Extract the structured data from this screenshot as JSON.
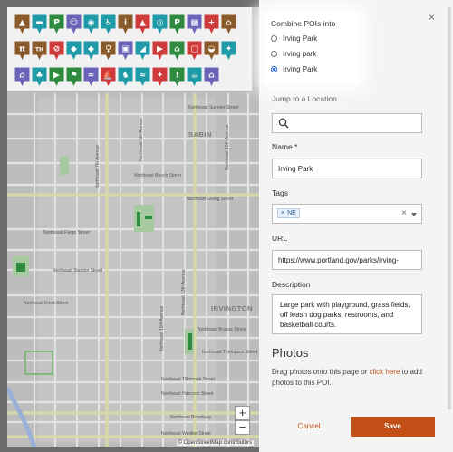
{
  "combine": {
    "title": "Combine POIs into",
    "options": [
      {
        "label": "Irving Park",
        "selected": false
      },
      {
        "label": "Irving park",
        "selected": false
      },
      {
        "label": "Irving Park",
        "selected": true
      }
    ]
  },
  "form": {
    "close_glyph": "×",
    "jump_label": "Jump to a Location",
    "jump_value": "",
    "name_label": "Name *",
    "name_value": "Irving Park",
    "tags_label": "Tags",
    "tag_chip": "NE",
    "tag_chip_remove": "×",
    "tags_clear": "×",
    "url_label": "URL",
    "url_value": "https://www.portland.gov/parks/irving-",
    "description_label": "Description",
    "description_value": "Large park with playground, grass fields, off leash dog parks, restrooms, and basketball courts.",
    "photos_title": "Photos",
    "photos_help_before": "Drag photos onto this page or ",
    "photos_help_link": "click here",
    "photos_help_after": " to add photos to this POI.",
    "cancel_label": "Cancel",
    "save_label": "Save"
  },
  "map": {
    "zoom_in": "+",
    "zoom_out": "−",
    "attribution": "© OpenStreetMap contributors",
    "areas": [
      "SABIN",
      "IRVINGTON"
    ],
    "streets_h": [
      "Northeast Beech Street",
      "Northeast Fargo Street",
      "Northeast Stanton Street",
      "Northeast Knott Street",
      "Northeast Brazee Street",
      "Northeast Thompson Street",
      "Northeast Tillamook Street",
      "Northeast Hancock Street",
      "Northeast Broadway",
      "Northeast Weidler Street",
      "Northeast Going Street",
      "Northeast Sumner Street"
    ],
    "streets_v": [
      "Northeast 7th Avenue",
      "Northeast 9th Avenue",
      "Northeast 11th Avenue",
      "Northeast 13th Avenue",
      "Northeast 15th Avenue"
    ]
  },
  "palette_icons": [
    "tent-icon",
    "bench-icon",
    "parking-icon",
    "restroom-icon",
    "camera-icon",
    "accessibility-icon",
    "info-icon",
    "picnic-tent-icon",
    "bicycle-icon",
    "bike-parking-icon",
    "grill-icon",
    "first-aid-icon",
    "cabin-icon",
    "picnic-table-icon",
    "trailhead-icon",
    "no-entry-icon",
    "water-drop-icon",
    "drinking-fountain-icon",
    "restroom-sign-icon",
    "visitor-center-icon",
    "sledding-icon",
    "theater-icon",
    "playground-icon",
    "trash-icon",
    "dog-icon",
    "wildlife-icon",
    "atm-icon",
    "hazard-icon",
    "coffee-icon",
    "shuttle-icon",
    "shop-icon",
    "binoculars-icon",
    "book-icon",
    "tree-icon",
    "golf-icon",
    "swim-icon",
    "boat-launch-icon",
    "horse-icon",
    "fish-icon",
    "boat-icon",
    "alert-icon",
    "swing-icon",
    "mountain-icon",
    "bus-icon",
    "bike-rental-icon"
  ],
  "colors": {
    "teal": "#1f9aa8",
    "green": "#2e8a3e",
    "purple": "#6b63b8",
    "red": "#cf3b3b",
    "brown": "#8a5a2b",
    "accent": "#c25016"
  }
}
